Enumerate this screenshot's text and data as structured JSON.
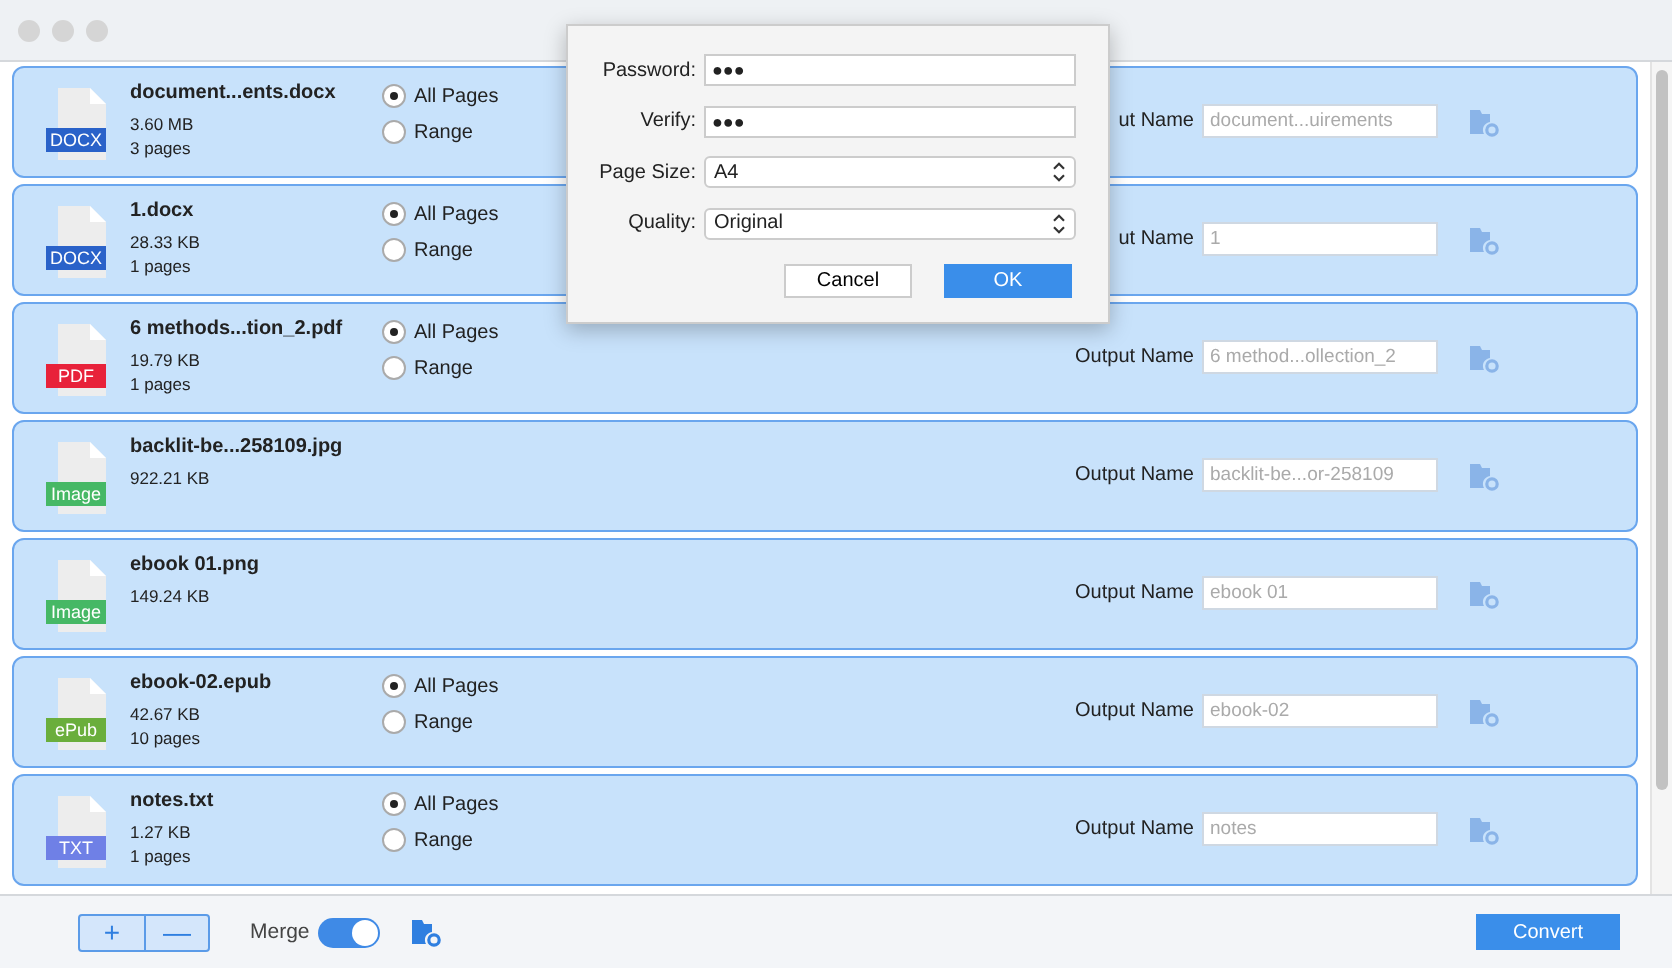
{
  "files": [
    {
      "name": "document...ents.docx",
      "size": "3.60 MB",
      "pages": "3 pages",
      "badge": "DOCX",
      "color": "#2a62c9",
      "options": [
        {
          "label": "All Pages",
          "selected": true
        },
        {
          "label": "Range",
          "selected": false
        }
      ],
      "output_label": "ut Name",
      "output_name": "document...uirements"
    },
    {
      "name": "1.docx",
      "size": "28.33 KB",
      "pages": "1 pages",
      "badge": "DOCX",
      "color": "#2a62c9",
      "options": [
        {
          "label": "All Pages",
          "selected": true
        },
        {
          "label": "Range",
          "selected": false
        }
      ],
      "output_label": "ut Name",
      "output_name": "1"
    },
    {
      "name": "6 methods...tion_2.pdf",
      "size": "19.79 KB",
      "pages": "1 pages",
      "badge": "PDF",
      "color": "#e8223a",
      "options": [
        {
          "label": "All Pages",
          "selected": true
        },
        {
          "label": "Range",
          "selected": false
        }
      ],
      "output_label": "Output Name",
      "output_name": "6 method...ollection_2"
    },
    {
      "name": "backlit-be...258109.jpg",
      "size": "922.21 KB",
      "badge": "Image",
      "color": "#46b865",
      "output_label": "Output Name",
      "output_name": "backlit-be...or-258109"
    },
    {
      "name": "ebook 01.png",
      "size": "149.24 KB",
      "badge": "Image",
      "color": "#46b865",
      "output_label": "Output Name",
      "output_name": "ebook 01"
    },
    {
      "name": "ebook-02.epub",
      "size": "42.67 KB",
      "pages": "10 pages",
      "badge": "ePub",
      "color": "#6aae3c",
      "options": [
        {
          "label": "All Pages",
          "selected": true
        },
        {
          "label": "Range",
          "selected": false
        }
      ],
      "output_label": "Output Name",
      "output_name": "ebook-02"
    },
    {
      "name": "notes.txt",
      "size": "1.27 KB",
      "pages": "1 pages",
      "badge": "TXT",
      "color": "#6f80e6",
      "options": [
        {
          "label": "All Pages",
          "selected": true
        },
        {
          "label": "Range",
          "selected": false
        }
      ],
      "output_label": "Output Name",
      "output_name": "notes"
    }
  ],
  "dialog": {
    "password_label": "Password:",
    "password": "●●●",
    "verify_label": "Verify:",
    "verify": "●●●",
    "page_size_label": "Page Size:",
    "page_size": "A4",
    "quality_label": "Quality:",
    "quality": "Original",
    "buttons": [
      "Cancel",
      "OK"
    ]
  },
  "bottom_bar": {
    "add": "+",
    "remove": "—",
    "merge_label": "Merge",
    "merge_on": true,
    "convert": "Convert"
  }
}
